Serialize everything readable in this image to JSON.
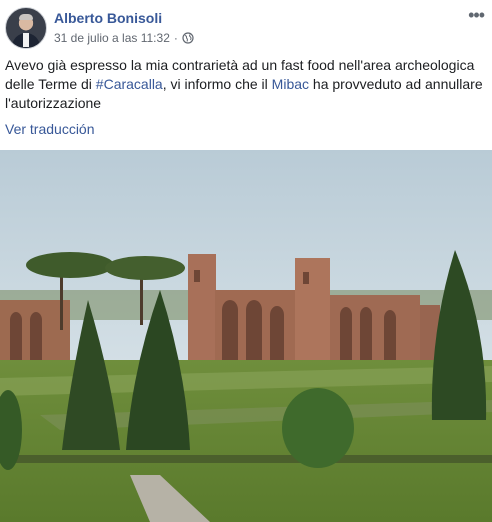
{
  "post": {
    "author": "Alberto Bonisoli",
    "timestamp": "31 de julio a las 11:32",
    "separator": "·",
    "privacy_icon": "globe-icon",
    "more_icon": "more-options-icon",
    "text_parts": {
      "intro": "Avevo già espresso la mia contrarietà ad un fast food nell'area archeologica delle Terme di ",
      "hashtag": "#Caracalla",
      "middle": ", vi informo che il ",
      "mention": "Mibac",
      "end": " ha provveduto ad annullare l'autorizzazione"
    },
    "translate_label": "Ver traducción",
    "photo_icon": "baths-of-caracalla-photo"
  },
  "colors": {
    "link": "#385898",
    "meta": "#616770",
    "text": "#1c1e21"
  }
}
